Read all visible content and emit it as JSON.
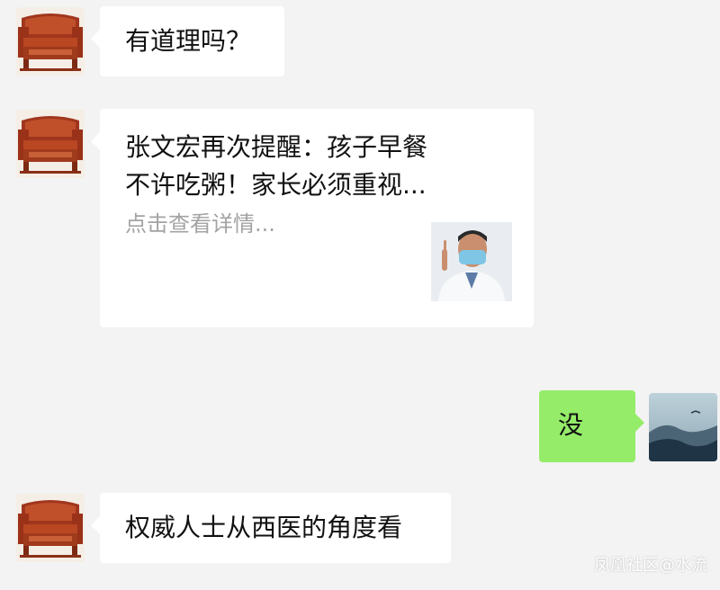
{
  "messages": [
    {
      "text": "有道理吗？"
    },
    {
      "card": {
        "title_line1": "张文宏再次提醒：孩子早餐",
        "title_line2": "不许吃粥！家长必须重视...",
        "desc": "点击查看详情..."
      }
    },
    {
      "text": "没"
    },
    {
      "text": "权威人士从西医的角度看"
    }
  ],
  "watermark": "凤凰社区@水流",
  "icons": {
    "incoming_avatar": "redwood-sofa-avatar",
    "outgoing_avatar": "misty-mountain-avatar",
    "card_thumbnail": "doctor-thumbnail"
  },
  "colors": {
    "background": "#f3f3f3",
    "incoming_bubble": "#ffffff",
    "outgoing_bubble": "#95ec69"
  }
}
